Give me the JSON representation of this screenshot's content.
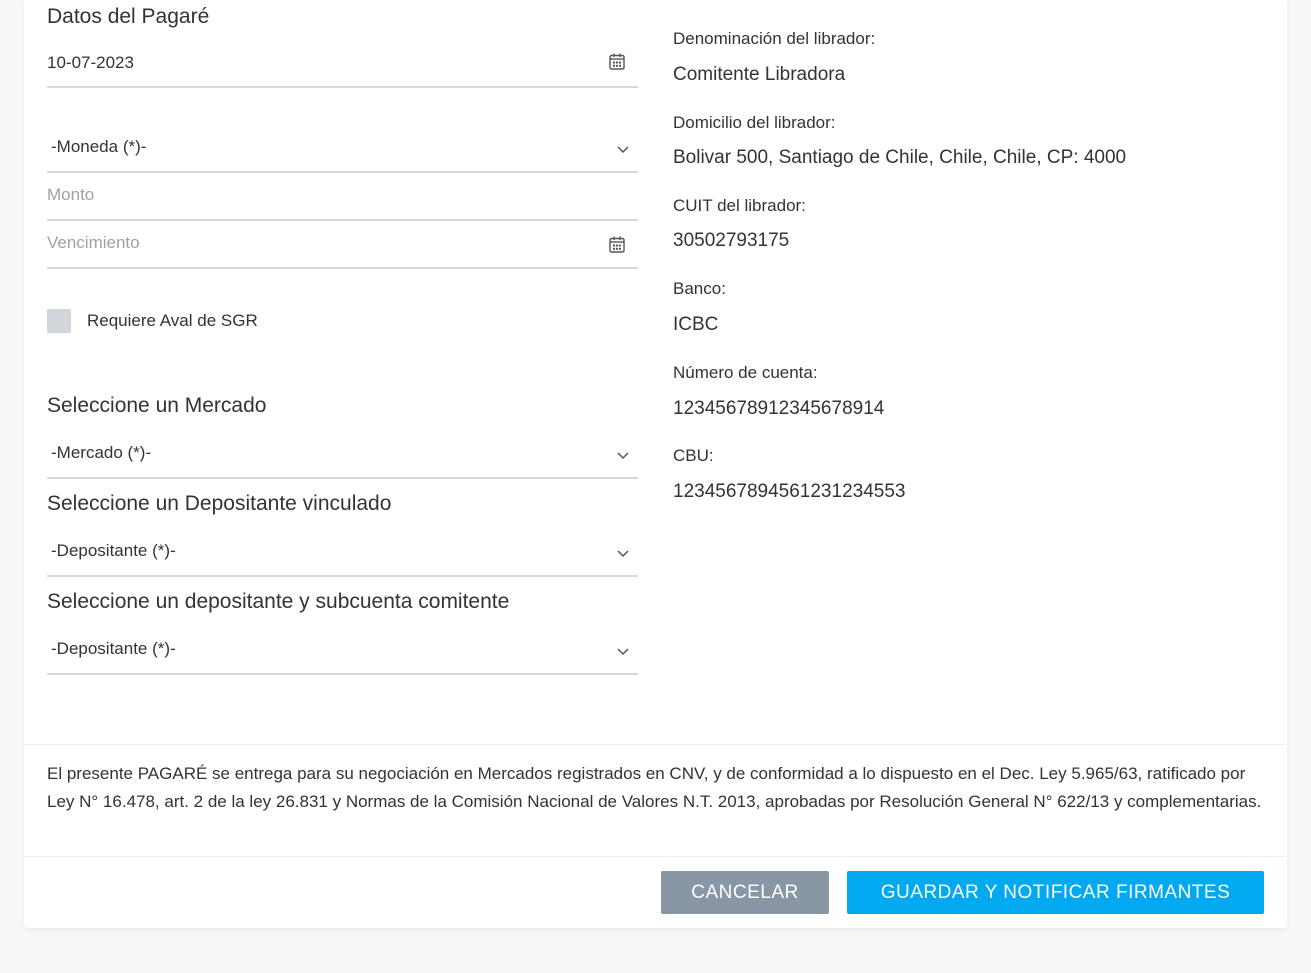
{
  "form": {
    "title": "Datos del Pagaré",
    "date_value": "10-07-2023",
    "moneda_placeholder": "-Moneda (*)-",
    "monto_placeholder": "Monto",
    "vencimiento_placeholder": "Vencimiento",
    "aval_label": "Requiere Aval de SGR",
    "mercado_heading": "Seleccione un Mercado",
    "mercado_placeholder": "-Mercado (*)-",
    "depositante_vinculado_heading": "Seleccione un Depositante vinculado",
    "depositante_vinculado_placeholder": "-Depositante (*)-",
    "subcuenta_heading": "Seleccione un depositante y subcuenta comitente",
    "subcuenta_placeholder": "-Depositante (*)-"
  },
  "librador": {
    "denominacion_label": "Denominación del librador:",
    "denominacion_value": "Comitente Libradora",
    "domicilio_label": "Domicilio del librador:",
    "domicilio_value": "Bolivar 500, Santiago de Chile, Chile, Chile, CP: 4000",
    "cuit_label": "CUIT del librador:",
    "cuit_value": "30502793175",
    "banco_label": "Banco:",
    "banco_value": "ICBC",
    "cuenta_label": "Número de cuenta:",
    "cuenta_value": "12345678912345678914",
    "cbu_label": "CBU:",
    "cbu_value": "1234567894561231234553"
  },
  "legal_text": "El presente PAGARÉ se entrega para su negociación en Mercados registrados en CNV, y de conformidad a lo dispuesto en el Dec. Ley 5.965/63, ratificado por Ley N° 16.478, art. 2 de la ley 26.831 y Normas de la Comisión Nacional de Valores N.T. 2013, aprobadas por Resolución General N° 622/13 y complementarias.",
  "actions": {
    "cancel_label": "CANCELAR",
    "save_label": "GUARDAR Y NOTIFICAR FIRMANTES"
  },
  "colors": {
    "primary": "#03a9f0",
    "secondary": "#8896a6",
    "underline": "#d5d8dc",
    "placeholder": "#9aa3ad"
  },
  "icons": [
    "calendar-icon",
    "chevron-down-icon"
  ]
}
